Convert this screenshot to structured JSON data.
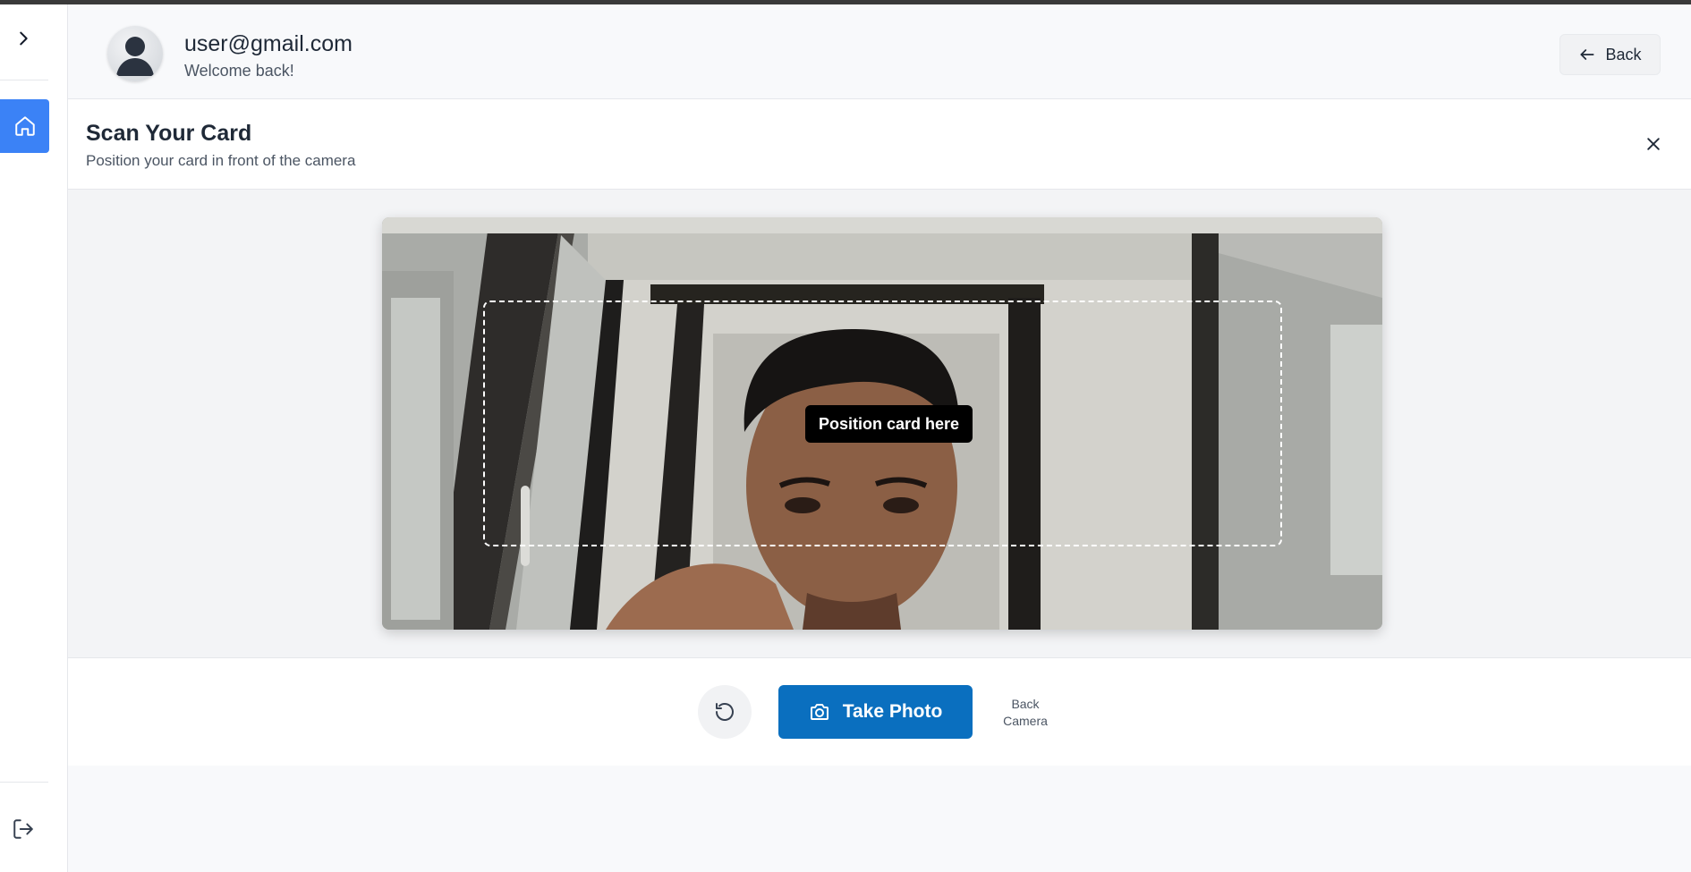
{
  "user": {
    "email": "user@gmail.com",
    "greeting": "Welcome back!"
  },
  "header": {
    "back_label": "Back"
  },
  "scan": {
    "title": "Scan Your Card",
    "subtitle": "Position your card in front of the camera",
    "guide_label": "Position card here"
  },
  "controls": {
    "take_photo_label": "Take Photo",
    "switch_camera_line1": "Back",
    "switch_camera_line2": "Camera"
  },
  "colors": {
    "accent": "#3b82f6",
    "primary_button": "#0a6fbf"
  },
  "icons": {
    "sidebar_toggle": "chevron-right-icon",
    "home": "home-icon",
    "logout": "logout-icon",
    "back": "arrow-left-icon",
    "close": "close-icon",
    "reset": "rotate-ccw-icon",
    "camera": "camera-icon"
  }
}
